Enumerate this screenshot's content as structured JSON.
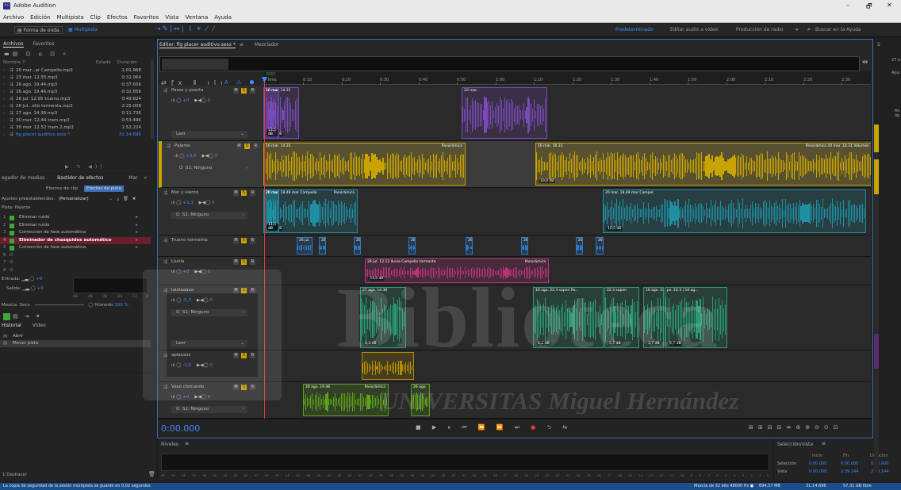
{
  "app": {
    "title": "Adobe Audition",
    "window_min": "–",
    "window_max": "🗗",
    "window_close": "✕"
  },
  "menu": [
    "Archivo",
    "Edición",
    "Multipista",
    "Clip",
    "Efectos",
    "Favoritos",
    "Vista",
    "Ventana",
    "Ayuda"
  ],
  "toolbar": {
    "waveform_label": "Forma de onda",
    "multitrack_label": "Multipista",
    "workspaces": [
      "Predeterminado",
      "Editar audio a vídeo",
      "Producción de radio"
    ],
    "more": "»",
    "search_placeholder": "Buscar en la Ayuda"
  },
  "files_panel": {
    "tabs": [
      "Archivos",
      "Favoritos"
    ],
    "col_name": "Nombre ↑",
    "col_status": "Estado",
    "col_duration": "Duración",
    "files": [
      {
        "name": "20 mar...ar Campello.mp3",
        "duration": "1:01.968"
      },
      {
        "name": "23 mar. 12.55.mp3",
        "duration": "0:32.064"
      },
      {
        "name": "26 ago. 19.44.mp3",
        "duration": "0:37.656"
      },
      {
        "name": "26 ago. 19.46.mp3",
        "duration": "0:32.856"
      },
      {
        "name": "26 jul. 12.05 trueno.mp3",
        "duration": "0:49.824"
      },
      {
        "name": "26 jul...ello tormenta.mp3",
        "duration": "2:25.008"
      },
      {
        "name": "27 ago. 14.38.mp3",
        "duration": "0:11.736"
      },
      {
        "name": "30 mar. 12.44 tram.mp3",
        "duration": "0:53.496"
      },
      {
        "name": "30 mar. 12.52 tram 2.mp3",
        "duration": "1:52.224"
      },
      {
        "name": "flg placer auditivo.sesx *",
        "duration": "31:14.696"
      }
    ]
  },
  "effects_panel": {
    "tabs": [
      "egador de medios",
      "Bastidor de efectos",
      "Mar",
      "»"
    ],
    "subtabs": [
      "Efectos de clip",
      "Efectos de pista"
    ],
    "presets_label": "Ajustes preestablecidos:",
    "presets_value": "(Personalizar)",
    "track_label": "Pista: Pajaros",
    "effects": [
      {
        "num": "1",
        "name": "Eliminar ruido",
        "active": false
      },
      {
        "num": "2",
        "name": "Eliminar ruido",
        "active": false
      },
      {
        "num": "3",
        "name": "Corrección de fase automática",
        "active": false
      },
      {
        "num": "4",
        "name": "Eliminador de chasquidos automático",
        "active": true
      },
      {
        "num": "5",
        "name": "Corrección de fase automática",
        "active": false
      },
      {
        "num": "6",
        "name": "",
        "active": false
      },
      {
        "num": "7",
        "name": "",
        "active": false
      },
      {
        "num": "8",
        "name": "",
        "active": false
      }
    ],
    "input_label": "Entrada:",
    "output_label": "Salida:",
    "input_val": "+0",
    "output_val": "+0",
    "meter_ticks": [
      "dB",
      "-48",
      "-36",
      "-24",
      "-12",
      "0"
    ],
    "mix_label": "Mezcla:",
    "mix_dry": "Seco",
    "mix_wet": "Húmedo",
    "mix_value": "100 %"
  },
  "history_panel": {
    "tabs": [
      "Historial",
      "Vídeo"
    ],
    "items": [
      "Abrir",
      "Mover pista"
    ],
    "undo": "1 Deshacer"
  },
  "editor": {
    "tab_title": "Editor: flg placer auditivo.sesx *",
    "mixer_tab": "Mezclador",
    "timecode": "0:00.000",
    "ruler_start": "hms",
    "eod": "EOD",
    "ruler_ticks": [
      "0:10",
      "0:20",
      "0:30",
      "0:40",
      "0:50",
      "1:00",
      "1:10",
      "1:20",
      "1:30",
      "1:40",
      "1:50",
      "2:00",
      "2:10",
      "2:20",
      "2:30"
    ]
  },
  "tracks": [
    {
      "name": "Pasos y puerta",
      "vol": "+0",
      "pan": "0",
      "mode": "Leer",
      "clips": [
        {
          "label": "10 mar. 14.31",
          "db": "11,7 dB",
          "color": "#7a4ab8"
        },
        {
          "label": "10 mar.",
          "db": "",
          "color": "#7a4ab8"
        },
        {
          "label": "10 mar.",
          "db": "",
          "color": "#7a4ab8"
        },
        {
          "label": "10 mar. 14.31",
          "db": "13,5 dB",
          "color": "#7a4ab8"
        }
      ]
    },
    {
      "name": "Pajaros",
      "vol": "+3,6",
      "pan": "0",
      "io": "S1: Ninguno",
      "clips": [
        {
          "label": "10 mar. 14.31",
          "extra": "Panorámica",
          "db": "",
          "color": "#c9a400"
        },
        {
          "label": "10 mar. 16.31",
          "extra": "Panorámica 10 mar. 14.31 Volumen",
          "db": "10,0 dB",
          "color": "#c9a400"
        }
      ]
    },
    {
      "name": "Mar y viento",
      "vol": "+3,3",
      "pan": "0",
      "io": "S1: Ninguno",
      "clips": [
        {
          "label": "20 mar. 18.49 mar Campello",
          "extra": "Panorámica",
          "db": "10,7 dB",
          "color": "#1f8fa3"
        },
        {
          "label": "20 mar. 18.49 mar Campel",
          "db": "10,5 dB",
          "color": "#1f8fa3"
        },
        {
          "label": "20 mar. 18.49 mar Campel",
          "db": "12,0 dB",
          "color": "#1f8fa3"
        },
        {
          "label": "20 mar. 18.49 mar Campel",
          "db": "10,5 dB",
          "color": "#1f8fa3"
        },
        {
          "label": "20 mar. 18.49 mar Campello Vol...",
          "db": "11,5 dB",
          "color": "#1f8fa3"
        }
      ]
    },
    {
      "name": "Trueno tormenta",
      "clips": [
        {
          "label": "26 jul.",
          "color": "#2b7ac9"
        },
        {
          "label": "26",
          "color": "#2b7ac9"
        },
        {
          "label": "26",
          "color": "#2b7ac9"
        },
        {
          "label": "26",
          "color": "#2b7ac9"
        },
        {
          "label": "26",
          "color": "#2b7ac9"
        },
        {
          "label": "26",
          "color": "#2b7ac9"
        },
        {
          "label": "26",
          "color": "#2b7ac9"
        },
        {
          "label": "26",
          "color": "#2b7ac9"
        }
      ]
    },
    {
      "name": "Lluvia",
      "vol": "+0",
      "pan": "0",
      "clips": [
        {
          "label": "26 jul. 12.12 lluvia Campello tormenta",
          "extra": "Panorámica",
          "db": "33,4 dB",
          "color": "#b8327a"
        }
      ]
    },
    {
      "name": "lalalaaaaa",
      "vol": "-5,3",
      "pan": "0",
      "io": "S1: Ninguno",
      "mode": "Leer",
      "clips": [
        {
          "label": "27 ago. 14.38",
          "db": "4,3 dB",
          "color": "#2a9c74"
        },
        {
          "label": "10 ago. 22.3 sopen Pa...",
          "db": "4,2 dB",
          "color": "#2a9c74"
        },
        {
          "label": "22.3 sopen",
          "db": "5,7 dB",
          "color": "#2a9c74"
        },
        {
          "label": "10 ago. 22.3 sopen",
          "db": "3,7 dB",
          "color": "#2a9c74"
        },
        {
          "label": "ps. 22.3 | 10 ag...",
          "db": "5,7 dB",
          "color": "#2a9c74"
        }
      ]
    },
    {
      "name": "aplausos",
      "vol": "-1,0",
      "pan": "0",
      "clips": [
        {
          "label": "",
          "color": "#b38c00"
        }
      ]
    },
    {
      "name": "Vaso chocando",
      "vol": "+0",
      "pan": "0",
      "io": "S1: Ninguno",
      "clips": [
        {
          "label": "26 ago. 19.46",
          "extra": "Panorámica",
          "color": "#5ca11a"
        },
        {
          "label": "26 ago.",
          "color": "#5ca11a"
        }
      ]
    }
  ],
  "levels_panel": {
    "title": "Niveles",
    "scale": [
      "dB",
      "-59",
      "-58",
      "-57",
      "-56",
      "-55",
      "-54",
      "-53",
      "-52",
      "-51",
      "-50",
      "-49",
      "-48",
      "-47",
      "-46",
      "-45",
      "-44",
      "-43",
      "-42",
      "-41",
      "-40",
      "-39",
      "-38",
      "-37",
      "-36",
      "-35",
      "-34",
      "-33",
      "-32",
      "-31",
      "-30",
      "-29",
      "-28",
      "-27",
      "-26",
      "-25",
      "-24",
      "-23",
      "-22",
      "-21",
      "-20",
      "-19",
      "-18",
      "-17",
      "-16",
      "-15",
      "-14",
      "-13",
      "-12",
      "-11",
      "-10",
      "-9",
      "-8",
      "-7",
      "-6",
      "-5",
      "-4",
      "-3",
      "-2",
      "-1",
      "0"
    ]
  },
  "selection_panel": {
    "title": "Selección/vista",
    "cols": [
      "Inicio",
      "Fin",
      "Duración"
    ],
    "rows": [
      {
        "label": "Selección",
        "start": "0:00.000",
        "end": "0:00.000",
        "dur": "0:00.000"
      },
      {
        "label": "Vista",
        "start": "0:00.000",
        "end": "2:39.144",
        "dur": "2:39.144"
      }
    ]
  },
  "status": {
    "left": "La copia de seguridad de la sesión multipista se guardó en 0,02 segundos",
    "sample": "Mezcla de 32 bits 48000 Hz ●",
    "mem": "694,57 MB",
    "dur": "31:14.696",
    "free": "57,31 GB libre"
  },
  "watermark": {
    "big": "Biblioteca",
    "sub": "UNIVERSITAS Miguel Hernández"
  },
  "right_panel": {
    "top": "S",
    "mid": "27 a",
    "aj": "Ajus",
    "side": "As op"
  }
}
